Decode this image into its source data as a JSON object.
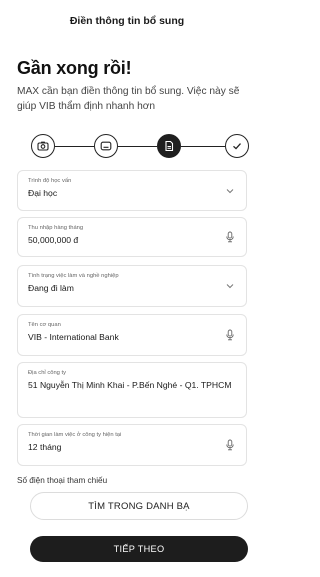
{
  "header": {
    "title": "Điền thông tin bổ sung"
  },
  "intro": {
    "headline": "Gần xong rồi!",
    "description": "MAX cần bạn điền thông tin bổ sung. Việc này sẽ giúp VIB thẩm định nhanh hơn"
  },
  "stepper": {
    "steps": [
      {
        "icon": "camera-icon",
        "state": "done"
      },
      {
        "icon": "id-card-icon",
        "state": "done"
      },
      {
        "icon": "document-icon",
        "state": "active"
      },
      {
        "icon": "check-icon",
        "state": "pending"
      }
    ]
  },
  "form": {
    "education": {
      "label": "Trình độ học vấn",
      "value": "Đại học",
      "icon": "chevron-down-icon"
    },
    "income": {
      "label": "Thu nhập hàng tháng",
      "value": "50,000,000 đ",
      "icon": "microphone-icon"
    },
    "employment": {
      "label": "Tình trạng việc làm và nghề nghiệp",
      "value": "Đang đi làm",
      "icon": "chevron-down-icon"
    },
    "employer": {
      "label": "Tên cơ quan",
      "value": "VIB - International Bank",
      "icon": "microphone-icon"
    },
    "address": {
      "label": "Địa chỉ công ty",
      "value": "51 Nguyễn Thị Minh Khai - P.Bến Nghé - Q1. TPHCM"
    },
    "tenure": {
      "label": "Thời gian làm việc ở công ty hiện tại",
      "value": "12 tháng",
      "icon": "microphone-icon"
    }
  },
  "reference": {
    "label": "Số điện thoại tham chiếu",
    "search_button": "TÌM TRONG DANH BẠ"
  },
  "footer": {
    "next_button": "TIẾP THEO"
  },
  "colors": {
    "primary": "#1d1d1d",
    "border": "#e3e3e3",
    "background": "#ffffff"
  }
}
